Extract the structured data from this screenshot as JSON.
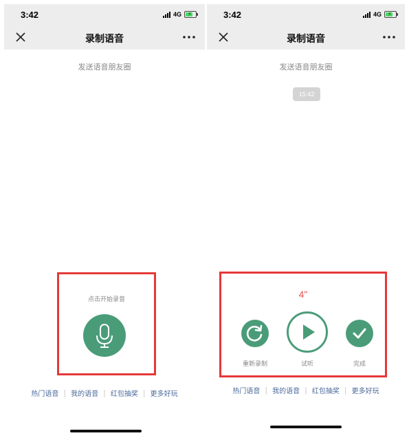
{
  "left": {
    "status": {
      "time": "3:42",
      "network": "4G"
    },
    "nav": {
      "title": "录制语音"
    },
    "subtitle": "发送语音朋友圈",
    "recorder": {
      "prompt": "点击开始录音"
    },
    "links": [
      "热门语音",
      "我的语音",
      "红包抽奖",
      "更多好玩"
    ]
  },
  "right": {
    "status": {
      "time": "3:42",
      "network": "4G"
    },
    "nav": {
      "title": "录制语音"
    },
    "subtitle": "发送语音朋友圈",
    "time_badge": "15:42",
    "recorder": {
      "duration": "4\"",
      "rerecord_label": "重新录制",
      "play_label": "试听",
      "done_label": "完成"
    },
    "links": [
      "热门语音",
      "我的语音",
      "红包抽奖",
      "更多好玩"
    ]
  },
  "colors": {
    "accent_green": "#4a9c79",
    "highlight_red": "#e53838",
    "duration_red": "#e5534b",
    "link_blue": "#4b6b9a",
    "nav_gray": "#ededed"
  },
  "icons": [
    "signal-icon",
    "battery-icon",
    "close-icon",
    "more-icon",
    "microphone-icon",
    "refresh-icon",
    "play-icon",
    "check-icon"
  ]
}
